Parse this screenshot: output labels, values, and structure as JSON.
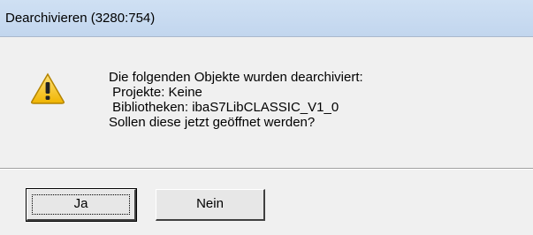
{
  "window": {
    "title": "Dearchivieren  (3280:754)"
  },
  "message": {
    "lines": [
      "Die folgenden Objekte wurden dearchiviert:",
      " Projekte: Keine",
      " Bibliotheken: ibaS7LibCLASSIC_V1_0",
      "Sollen diese jetzt geöffnet werden?"
    ],
    "icon": "warning-icon"
  },
  "buttons": {
    "yes_label": "Ja",
    "no_label": "Nein"
  },
  "colors": {
    "titlebar": "#c6daf0",
    "warning_fill": "#f4c20d",
    "background": "#f0f0f0"
  }
}
